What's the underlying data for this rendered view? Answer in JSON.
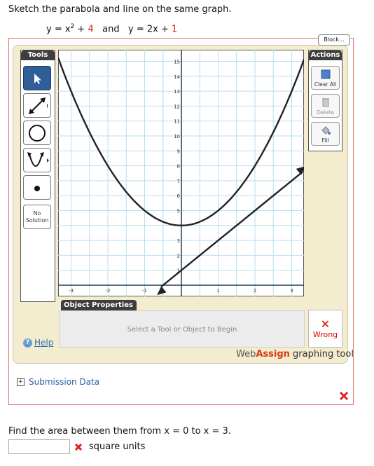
{
  "prompt": "Sketch the parabola and line on the same graph.",
  "equations": {
    "eq1_prefix": "y = x",
    "eq1_exp": "2",
    "eq1_plus": " + ",
    "eq1_const": "4",
    "and": "and",
    "eq2_prefix": "y = 2x + ",
    "eq2_const": "1"
  },
  "block_button": "Block...",
  "tools": {
    "header": "Tools",
    "no_solution": [
      "No",
      "Solution"
    ]
  },
  "actions": {
    "header": "Actions",
    "clear_all": "Clear All",
    "delete": "Delete",
    "fill": "Fill"
  },
  "graph": {
    "x_ticks": [
      "-3",
      "-2",
      "-1",
      "1",
      "2",
      "3"
    ],
    "y_ticks": [
      "15",
      "14",
      "13",
      "12",
      "11",
      "10",
      "9",
      "8",
      "7",
      "6",
      "5",
      "3",
      "2",
      "1"
    ]
  },
  "object_properties": {
    "tab": "Object Properties",
    "hint": "Select a Tool or Object to Begin"
  },
  "status": {
    "wrong": "Wrong"
  },
  "help": "Help",
  "branding": {
    "part1": "Web",
    "part2": "Assign",
    "part3": " graphing tool"
  },
  "submission_data": "Submission Data",
  "area_question": "Find the area between them from x = 0 to x = 3.",
  "answer": {
    "value": "",
    "units": "square units"
  },
  "colors": {
    "accent_red": "#e02020",
    "tool_selected": "#2f5f99",
    "grid": "#b8dff2",
    "curve": "#222222",
    "link": "#2b6fb0"
  }
}
